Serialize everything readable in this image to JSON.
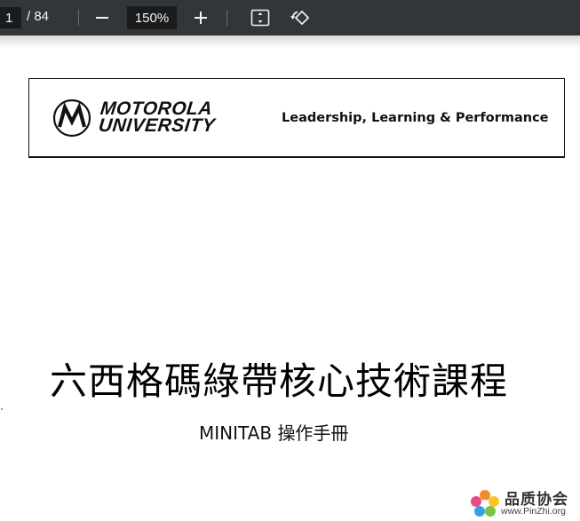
{
  "toolbar": {
    "page_current": "1",
    "page_total": "/ 84",
    "zoom_value": "150%"
  },
  "icons": {
    "zoom_out": "minus-icon",
    "zoom_in": "plus-icon",
    "fit_page": "fit-to-page-icon",
    "rotate": "rotate-icon"
  },
  "document": {
    "banner": {
      "university_line1": "MOTOROLA",
      "university_line2": "UNIVERSITY",
      "tagline": "Leadership, Learning & Performance"
    },
    "title": "六西格碼綠帶核心技術課程",
    "subtitle": "MINITAB 操作手冊"
  },
  "watermark": {
    "name": "品质协会",
    "url": "www.PinZhi.org"
  },
  "colors": {
    "toolbar_bg": "#323639",
    "toolbar_field_bg": "#191b1c",
    "toolbar_text": "#f1f3f4",
    "page_bg": "#ffffff"
  }
}
